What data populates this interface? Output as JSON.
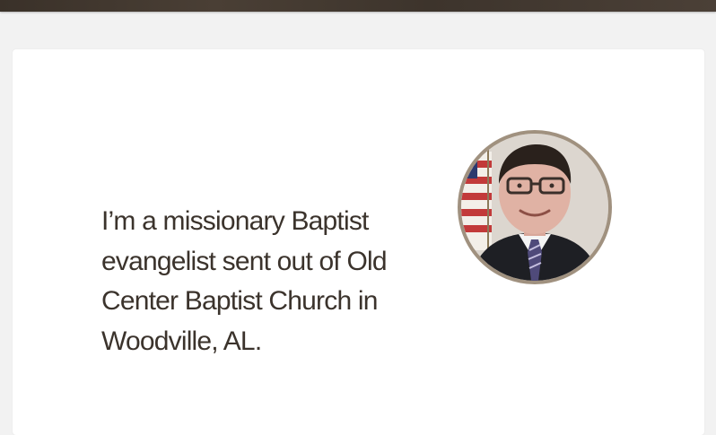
{
  "profile": {
    "intro": "I’m a missionary Baptist evangelist sent out of Old Center Baptist Church in Woodville, AL.",
    "photo_alt": "portrait-photo"
  },
  "colors": {
    "page_bg": "#f2f2f2",
    "banner": "#3f362e",
    "text": "#3b332c",
    "avatar_border": "#a0917f"
  }
}
